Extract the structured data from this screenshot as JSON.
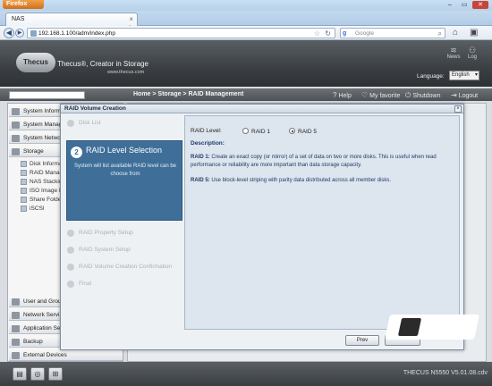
{
  "browser": {
    "app_button": "Firefox",
    "tab_title": "NAS",
    "url": "192.168.1.100/adm/index.php",
    "search_placeholder": "Google"
  },
  "header": {
    "tagline": "Thecus®, Creator in Storage",
    "tagline_sub": "www.thecus.com",
    "logo_text": "Thecus",
    "news": "News",
    "log": "Log",
    "language_label": "Language:",
    "language_value": "English"
  },
  "toolbar": {
    "breadcrumb": "Home > Storage > RAID Management",
    "help": "Help",
    "favorite": "My favorite",
    "shutdown": "Shutdown",
    "logout": "Logout"
  },
  "sidebar": {
    "top_items": [
      "System Inform",
      "System Manage",
      "System Netwo",
      "Storage"
    ],
    "storage_children": [
      "Disk Informati",
      "RAID Manager",
      "NAS Stacking",
      "ISO Image Mo",
      "Share Folders",
      "iSCSI"
    ],
    "bottom_items": [
      "User and Grou",
      "Network Servi",
      "Application Se",
      "Backup",
      "External Devices"
    ]
  },
  "dialog": {
    "title": "RAID Volume Creation",
    "steps": {
      "disk_list": "Disk List",
      "active_number": "2",
      "active_title": "RAID Level Selection",
      "active_desc": "System will list available RAID level can be choose from",
      "after": [
        "RAID Property Setup",
        "RAID System Setup",
        "RAID Volume Creation Confirmation",
        "Final"
      ]
    },
    "raid_level_label": "RAID Level:",
    "option_raid1": "RAID 1",
    "option_raid5": "RAID 5",
    "selected": "RAID 5",
    "description_label": "Description:",
    "raid1_title": "RAID 1:",
    "raid1_text": "Create an exact copy (or mirror) of a set of data on two or more disks. This is useful when read performance or reliability are more important than data storage capacity.",
    "raid5_title": "RAID 5:",
    "raid5_text": "Use block-level striping with parity data distributed across all member disks.",
    "prev_button": "Prev"
  },
  "footer": {
    "version": "THECUS N5550 V5.01.08.cdv"
  }
}
